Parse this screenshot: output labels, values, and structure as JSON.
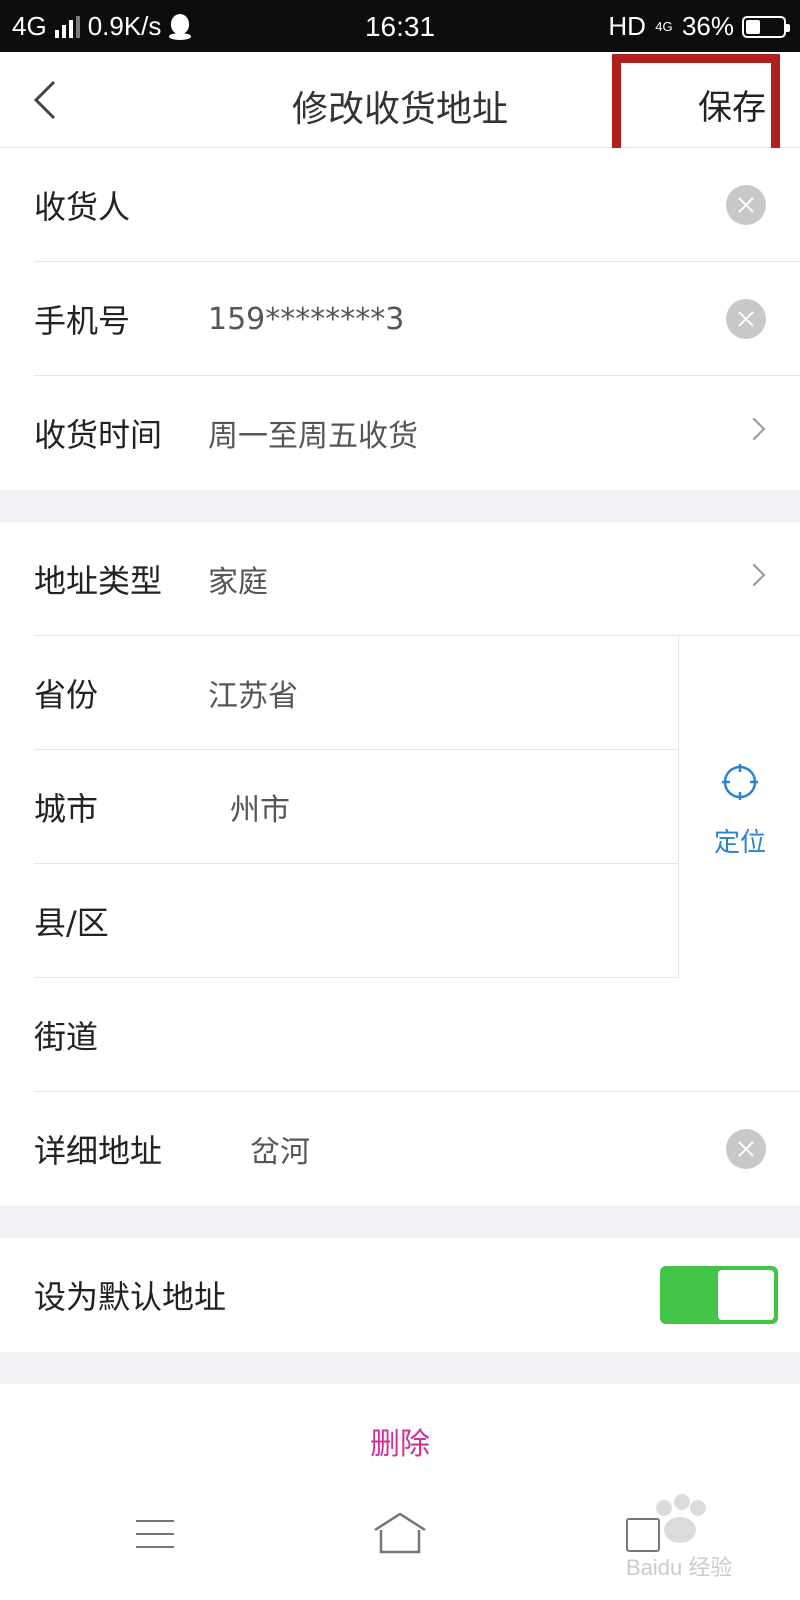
{
  "status_bar": {
    "network": "4G",
    "speed": "0.9K/s",
    "time": "16:31",
    "hd": "HD",
    "net_small": "4G",
    "battery": "36%"
  },
  "nav": {
    "title": "修改收货地址",
    "save_label": "保存"
  },
  "contact": {
    "recipient_label": "收货人",
    "recipient_value": "",
    "phone_label": "手机号",
    "phone_value": "159********3",
    "time_label": "收货时间",
    "time_value": "周一至周五收货"
  },
  "address": {
    "type_label": "地址类型",
    "type_value": "家庭",
    "province_label": "省份",
    "province_value": "江苏省",
    "city_label": "城市",
    "city_value": "州市",
    "district_label": "县/区",
    "district_value": "",
    "street_label": "街道",
    "street_value": "",
    "detail_label": "详细地址",
    "detail_value": "岔河",
    "locate_label": "定位"
  },
  "default": {
    "label": "设为默认地址",
    "enabled": true
  },
  "delete_label": "删除",
  "watermark": "Baidu 经验",
  "colors": {
    "accent_green": "#42c447",
    "locate_blue": "#2a82d2",
    "delete_pink": "#d0309a",
    "annotation_red": "#b11e1e"
  }
}
